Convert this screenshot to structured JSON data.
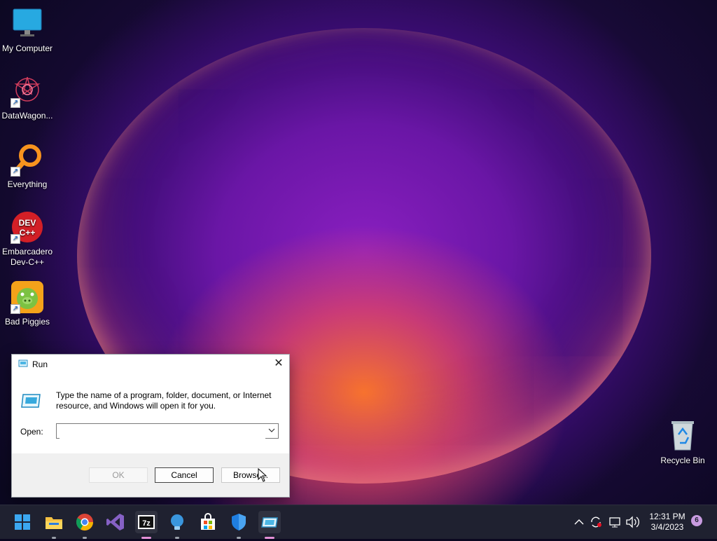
{
  "desktop": {
    "icons": [
      {
        "name": "My Computer"
      },
      {
        "name": "DataWagon..."
      },
      {
        "name": "Everything"
      },
      {
        "name": "Embarcadero Dev-C++"
      },
      {
        "name": "Bad Piggies"
      },
      {
        "name": "Recycle Bin"
      }
    ]
  },
  "run_dialog": {
    "title": "Run",
    "close_glyph": "✕",
    "description": "Type the name of a program, folder, document, or Internet resource, and Windows will open it for you.",
    "open_label": "Open:",
    "open_value": "",
    "buttons": {
      "ok": "OK",
      "cancel": "Cancel",
      "browse": "Browse..."
    }
  },
  "taskbar": {
    "apps": [
      "start-button",
      "file-explorer",
      "chrome",
      "visual-studio",
      "7-zip",
      "lightbulb-app",
      "microsoft-store",
      "windows-security",
      "run"
    ],
    "active_app": "run",
    "tray": {
      "time": "12:31 PM",
      "date": "3/4/2023",
      "notification_count": "6"
    }
  },
  "colors": {
    "accent": "#e38fd6",
    "taskbar": "#1f2130",
    "dialog_footer": "#f0f0f0"
  }
}
